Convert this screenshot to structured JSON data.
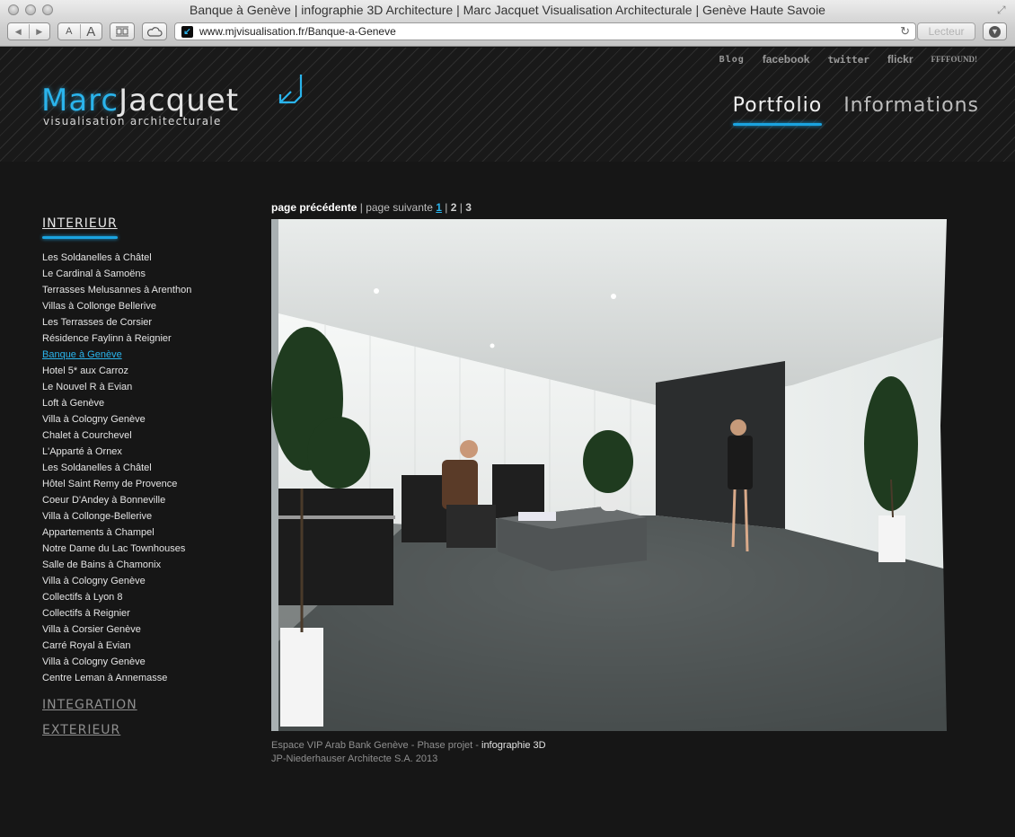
{
  "browser": {
    "window_title": "Banque à Genève | infographie 3D Architecture | Marc Jacquet Visualisation Architecturale | Genève Haute Savoie",
    "url": "www.mjvisualisation.fr/Banque-a-Geneve",
    "reader_label": "Lecteur",
    "font_small": "A",
    "font_big": "A",
    "back_icon": "◀",
    "forward_icon": "▶",
    "reload_icon": "↻",
    "favicon_glyph": "↙",
    "fullscreen_icon": "⤢"
  },
  "header": {
    "logo": {
      "first": "Marc",
      "last": "Jacquet",
      "tagline": "visualisation architecturale"
    },
    "social": [
      {
        "label": "Blog"
      },
      {
        "label": "facebook"
      },
      {
        "label": "twitter"
      },
      {
        "label": "flickr"
      },
      {
        "label": "FFFFOUND!"
      }
    ],
    "nav": [
      {
        "label": "Portfolio",
        "active": true
      },
      {
        "label": "Informations",
        "active": false
      }
    ],
    "accent_color": "#2ab4ec"
  },
  "sidebar": {
    "categories": {
      "interieur": "INTERIEUR",
      "integration": "INTEGRATION",
      "exterieur": "EXTERIEUR"
    },
    "projects": [
      "Les Soldanelles à Châtel",
      "Le Cardinal à Samoëns",
      "Terrasses Melusannes à Arenthon",
      "Villas à Collonge Bellerive",
      "Les Terrasses de Corsier",
      "Résidence Faylinn à Reignier",
      "Banque à Genève",
      "Hotel 5* aux Carroz",
      "Le Nouvel R à Evian",
      "Loft à Genève",
      "Villa à Cologny Genève",
      "Chalet à Courchevel",
      "L'Apparté à Ornex",
      "Les Soldanelles à Châtel",
      "Hôtel Saint Remy de Provence",
      "Coeur D'Andey à Bonneville",
      "Villa à Collonge-Bellerive",
      "Appartements à Champel",
      "Notre Dame du Lac Townhouses",
      "Salle de Bains à Chamonix",
      "Villa à Cologny Genève",
      "Collectifs à Lyon 8",
      "Collectifs à Reignier",
      "Villa à Corsier Genève",
      "Carré Royal à Evian",
      "Villa à Cologny Genève",
      "Centre Leman à Annemasse"
    ],
    "current_index": 6
  },
  "pager": {
    "prev": "page précédente",
    "separator": "|",
    "next": "page suivante",
    "pages": [
      "1",
      "2",
      "3"
    ],
    "current_page": "1"
  },
  "image": {
    "alt": "Rendu 3D : espace VIP d'une banque, salon avec fauteuils noirs, table basse, plantes vertes, homme assis lisant et femme marchant devant une porte noire"
  },
  "caption": {
    "line1_plain": "Espace VIP Arab Bank Genève - Phase projet - ",
    "line1_strong": "infographie 3D",
    "line2": "JP-Niederhauser Architecte S.A. 2013"
  }
}
